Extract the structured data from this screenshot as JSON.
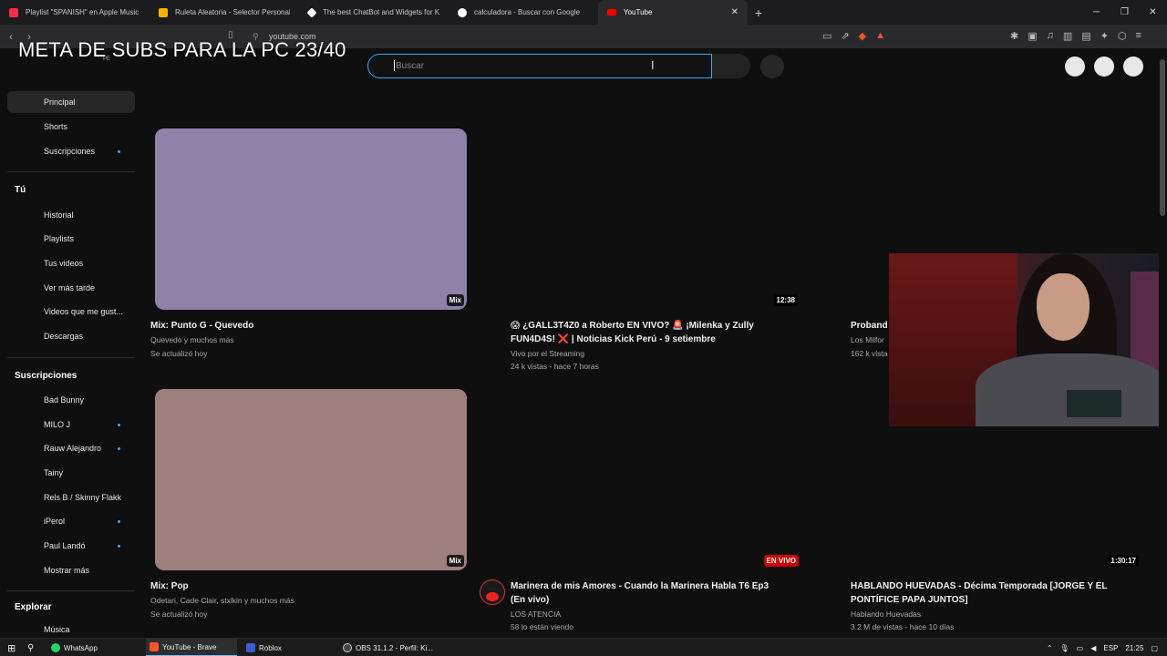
{
  "browser": {
    "tabs": [
      {
        "label": "Playlist \"SPANISH\" en Apple Music",
        "color": "#fa2d48"
      },
      {
        "label": "Ruleta Aleatoria - Selector Personaliz",
        "color": "#f4b400"
      },
      {
        "label": "The best ChatBot and Widgets for Ki",
        "color": "#ffffff"
      },
      {
        "label": "calculadora - Buscar con Google",
        "color": "#4285f4"
      },
      {
        "label": "YouTube",
        "color": "#ff0000",
        "active": true
      }
    ],
    "url": "youtube.com",
    "new_tab": "+",
    "close_tab": "✕"
  },
  "overlay": {
    "title": "META DE SUBS PARA LA PC 23/40",
    "country": "PE"
  },
  "search": {
    "placeholder": "Buscar"
  },
  "sidebar": {
    "main": [
      {
        "label": "Principal",
        "active": true
      },
      {
        "label": "Shorts"
      },
      {
        "label": "Suscripciones",
        "dot": true
      }
    ],
    "you_heading": "Tú",
    "you": [
      {
        "label": "Historial"
      },
      {
        "label": "Playlists"
      },
      {
        "label": "Tus videos"
      },
      {
        "label": "Ver más tarde"
      },
      {
        "label": "Videos que me gust..."
      },
      {
        "label": "Descargas"
      }
    ],
    "subs_heading": "Suscripciones",
    "subs": [
      {
        "label": "Bad Bunny"
      },
      {
        "label": "MILO J",
        "dot": true
      },
      {
        "label": "Rauw Alejandro",
        "dot": true
      },
      {
        "label": "Tainy"
      },
      {
        "label": "Rels B / Skinny Flakk"
      },
      {
        "label": "iPerol",
        "dot": true
      },
      {
        "label": "Paul Landó",
        "dot": true
      },
      {
        "label": "Mostrar más"
      }
    ],
    "explore_heading": "Explorar",
    "explore": [
      {
        "label": "Música"
      }
    ]
  },
  "videos": [
    {
      "title": "Mix: Punto G - Quevedo",
      "meta1": "Quevedo y muchos más",
      "meta2": "Se actualizó hoy",
      "badge": "Mix",
      "color": "#8e82a8"
    },
    {
      "title": "😱 ¿GALL3T4Z0 a Roberto EN VIVO? 🚨 ¡Milenka y Zully FUN4D4S! ❌ | Noticias Kick Perú - 9 setiembre",
      "meta1": "Vivo por el Streaming",
      "meta2": "24 k vistas - hace 7 horas",
      "badge": "12:38"
    },
    {
      "title": "Proband",
      "meta1": "Los Milfor",
      "meta2": "162 k vista"
    },
    {
      "title": "Mix: Pop",
      "meta1": "Odetari, Cade Clair, stxlkin y muchos más",
      "meta2": "Se actualizó hoy",
      "badge": "Mix",
      "color": "#9e7f7d"
    },
    {
      "title": "Marinera de mis Amores - Cuando la Marinera Habla  T6 Ep3 (En vivo)",
      "meta1": "LOS ATENCIA",
      "meta2": "58 lo están viendo",
      "badge": "EN VIVO"
    },
    {
      "title": "HABLANDO HUEVADAS - Décima Temporada [JORGE Y EL PONTÍFICE PAPA JUNTOS]",
      "meta1": "Hablando Huevadas",
      "meta2": "3.2 M de vistas - hace 10 días",
      "badge": "1:30:17"
    }
  ],
  "taskbar": {
    "items": [
      {
        "label": "WhatsApp",
        "color": "#25d366"
      },
      {
        "label": "YouTube - Brave",
        "color": "#fb542b",
        "active": true
      },
      {
        "label": "Roblox",
        "color": "#3b5bdb"
      },
      {
        "label": "OBS 31.1.2 - Perfil: Ki...",
        "color": "#444444"
      }
    ],
    "lang": "ESP",
    "time": "21:25"
  }
}
